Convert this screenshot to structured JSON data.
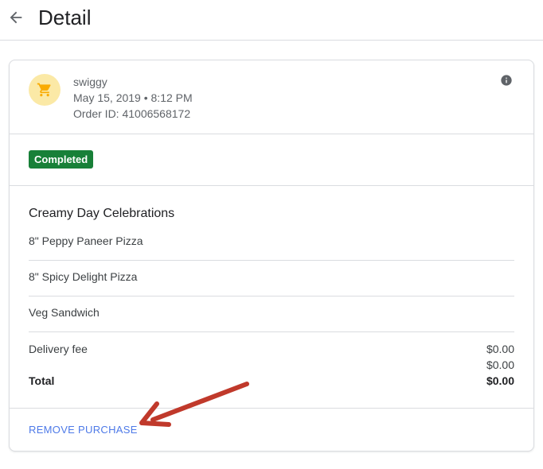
{
  "header": {
    "title": "Detail",
    "back_icon": "arrow-left-icon"
  },
  "merchant": {
    "name": "swiggy",
    "datetime": "May 15, 2019 • 8:12 PM",
    "order_id": "Order ID: 41006568172",
    "icon": "shopping-cart-icon",
    "info_icon": "info-icon"
  },
  "status": {
    "label": "Completed"
  },
  "order": {
    "name": "Creamy Day Celebrations",
    "items": [
      {
        "label": "8\" Peppy Paneer Pizza"
      },
      {
        "label": "8\" Spicy Delight Pizza"
      },
      {
        "label": "Veg Sandwich"
      }
    ]
  },
  "fees": {
    "delivery_label": "Delivery fee",
    "delivery_value": "$0.00",
    "extra_value": "$0.00",
    "total_label": "Total",
    "total_value": "$0.00"
  },
  "actions": {
    "remove_label": "REMOVE PURCHASE"
  },
  "colors": {
    "status_green": "#188038",
    "link_blue": "#4e7ae8",
    "avatar_bg": "#fbe9a6",
    "cart_yellow": "#f9ab00",
    "annotation_red": "#c0392b"
  }
}
